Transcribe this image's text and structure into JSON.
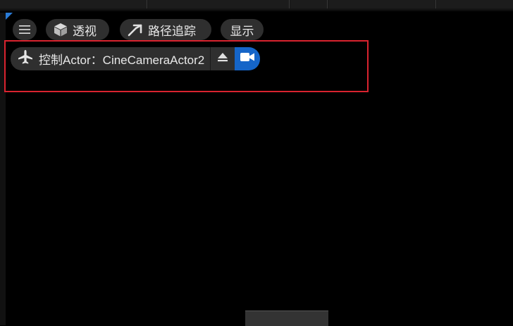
{
  "toolbar": {
    "perspective_label": "透视",
    "pathtracing_label": "路径追踪",
    "show_label": "显示"
  },
  "pilot": {
    "label": "控制Actor：CineCameraActor2"
  },
  "colors": {
    "highlight": "#d9232f",
    "camera_active": "#1565c8"
  },
  "icons": {
    "menu": "hamburger-icon",
    "perspective": "cube-icon",
    "pathtracing": "ray-icon",
    "pilot": "plane-icon",
    "eject": "eject-icon",
    "camera": "video-camera-icon"
  }
}
